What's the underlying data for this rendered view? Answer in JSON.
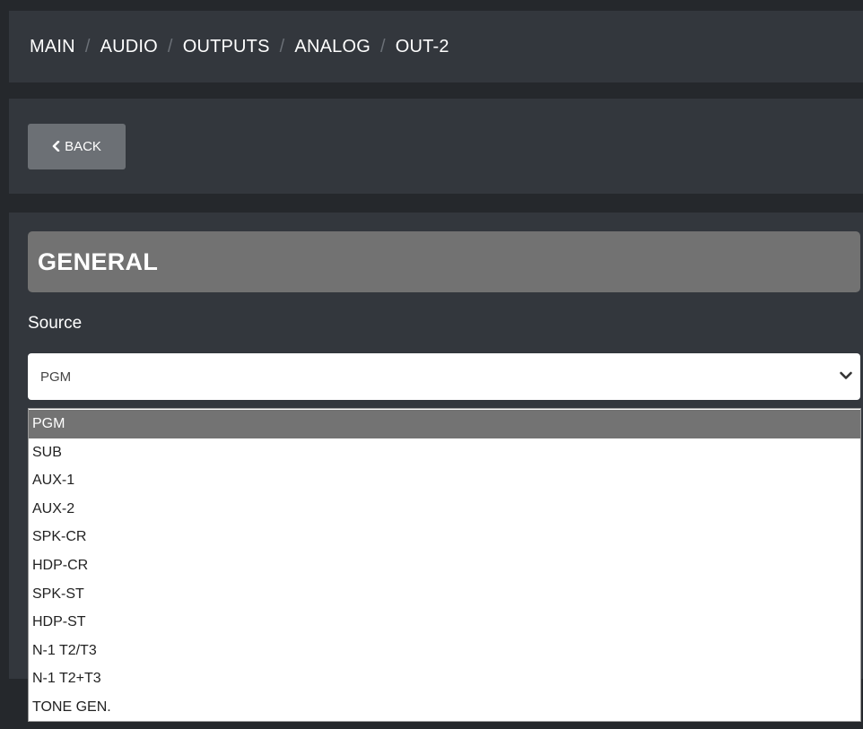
{
  "breadcrumb": {
    "items": [
      "MAIN",
      "AUDIO",
      "OUTPUTS",
      "ANALOG",
      "OUT-2"
    ],
    "separator": "/"
  },
  "back_button": {
    "icon": "chevron-left-icon",
    "label": "BACK"
  },
  "section": {
    "title": "GENERAL"
  },
  "source_field": {
    "label": "Source",
    "selected_value": "PGM",
    "icon": "chevron-down-icon",
    "options": [
      "PGM",
      "SUB",
      "AUX-1",
      "AUX-2",
      "SPK-CR",
      "HDP-CR",
      "SPK-ST",
      "HDP-ST",
      "N-1 T2/T3",
      "N-1 T2+T3",
      "TONE GEN."
    ],
    "highlighted_option": "PGM"
  },
  "colors": {
    "page_background": "#25282c",
    "panel_background": "#33373d",
    "section_header": "#727272",
    "back_button": "#6c7075",
    "highlight": "#737373"
  }
}
